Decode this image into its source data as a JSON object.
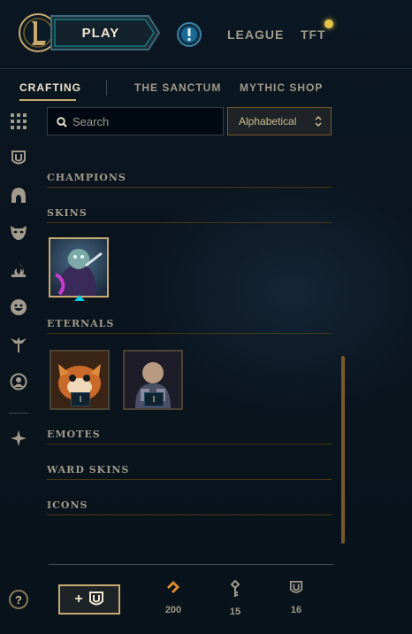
{
  "topbar": {
    "play_label": "PLAY",
    "nav": [
      "LEAGUE",
      "TFT"
    ]
  },
  "subtabs": {
    "items": [
      "CRAFTING",
      "THE SANCTUM",
      "MYTHIC SHOP"
    ],
    "active": "CRAFTING"
  },
  "sidebar": {
    "icons": [
      "grid-icon",
      "chest-icon",
      "champion-helmet-icon",
      "skin-mask-icon",
      "eternals-flame-icon",
      "emote-face-icon",
      "ward-icon",
      "summoner-icon-icon",
      "other-icon"
    ]
  },
  "search": {
    "placeholder": "Search",
    "value": ""
  },
  "sort": {
    "selected": "Alphabetical"
  },
  "categories": [
    {
      "label": "CHAMPIONS"
    },
    {
      "label": "SKINS"
    },
    {
      "label": "ETERNALS"
    },
    {
      "label": "EMOTES"
    },
    {
      "label": "WARD SKINS"
    },
    {
      "label": "ICONS"
    }
  ],
  "eternals": [
    {
      "badge": "I"
    },
    {
      "badge": "I"
    }
  ],
  "footer": {
    "help_label": "?",
    "add_label": "+",
    "currencies": [
      {
        "icon": "orange-essence-icon",
        "value": "200"
      },
      {
        "icon": "key-icon",
        "value": "15"
      },
      {
        "icon": "chest-icon",
        "value": "16"
      }
    ]
  },
  "colors": {
    "gold": "#c8aa6e",
    "accent_blue": "#0acbe6",
    "orange_essence": "#e08a2c"
  }
}
